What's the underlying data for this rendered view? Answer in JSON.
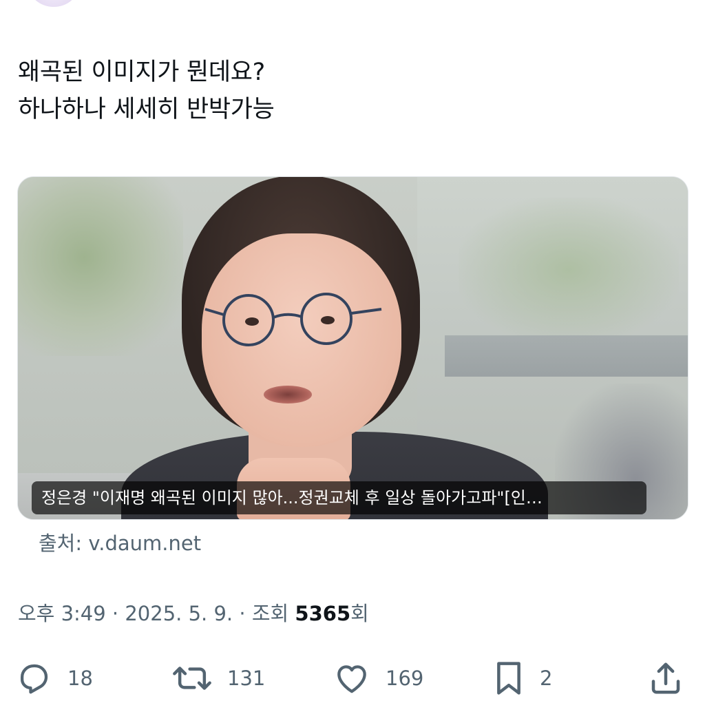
{
  "tweet": {
    "text_line_1": "왜곡된 이미지가 뭔데요?",
    "text_line_2": "하나하나 세세히 반박가능"
  },
  "card": {
    "caption": "정은경 \"이재명 왜곡된 이미지 많아...정권교체 후 일상 돌아가고파\"[인…",
    "source": "출처: v.daum.net"
  },
  "meta": {
    "time": "오후 3:49",
    "separator": "·",
    "date": "2025. 5. 9.",
    "views_label": "조회",
    "views_count": "5365",
    "views_unit": "회"
  },
  "actions": {
    "replies": "18",
    "retweets": "131",
    "likes": "169",
    "bookmarks": "2"
  },
  "icons": {
    "reply": "speech-bubble-icon",
    "retweet": "retweet-arrows-icon",
    "like": "heart-icon",
    "bookmark": "bookmark-icon",
    "share": "share-upload-icon"
  },
  "colors": {
    "text_primary": "#0f1419",
    "text_secondary": "#536471"
  }
}
